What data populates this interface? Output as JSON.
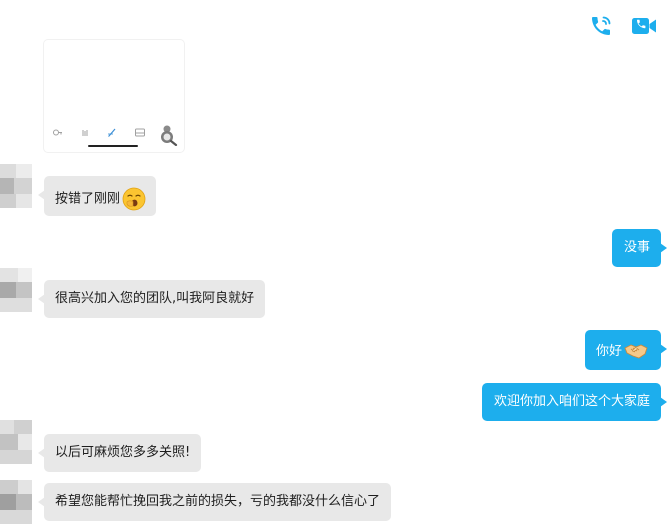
{
  "header": {
    "voice_call_icon": "phone-icon",
    "video_call_icon": "video-camera-icon",
    "accent_color": "#1daeed"
  },
  "thumbnail": {
    "tabs": [
      {
        "label": "",
        "icon": "key-icon"
      },
      {
        "label": "",
        "icon": "signal-icon"
      },
      {
        "label": "",
        "icon": "edit-icon"
      },
      {
        "label": "",
        "icon": "tray-icon"
      },
      {
        "label": "",
        "icon": "zoom-icon"
      }
    ]
  },
  "messages": [
    {
      "side": "left",
      "text": "按错了刚刚",
      "emoji": "yawning-face-emoji"
    },
    {
      "side": "right",
      "text": "没事"
    },
    {
      "side": "left",
      "text": "很高兴加入您的团队,叫我阿良就好"
    },
    {
      "side": "right",
      "text": "你好",
      "emoji": "handshake-emoji"
    },
    {
      "side": "right",
      "text": "欢迎你加入咱们这个大家庭"
    },
    {
      "side": "left",
      "text": "以后可麻烦您多多关照!"
    },
    {
      "side": "left",
      "text": "希望您能帮忙挽回我之前的损失，亏的我都没什么信心了"
    }
  ],
  "colors": {
    "incoming_bubble": "#e8e8e8",
    "outgoing_bubble": "#1daeed",
    "incoming_text": "#1e1e1e",
    "outgoing_text": "#ffffff"
  }
}
